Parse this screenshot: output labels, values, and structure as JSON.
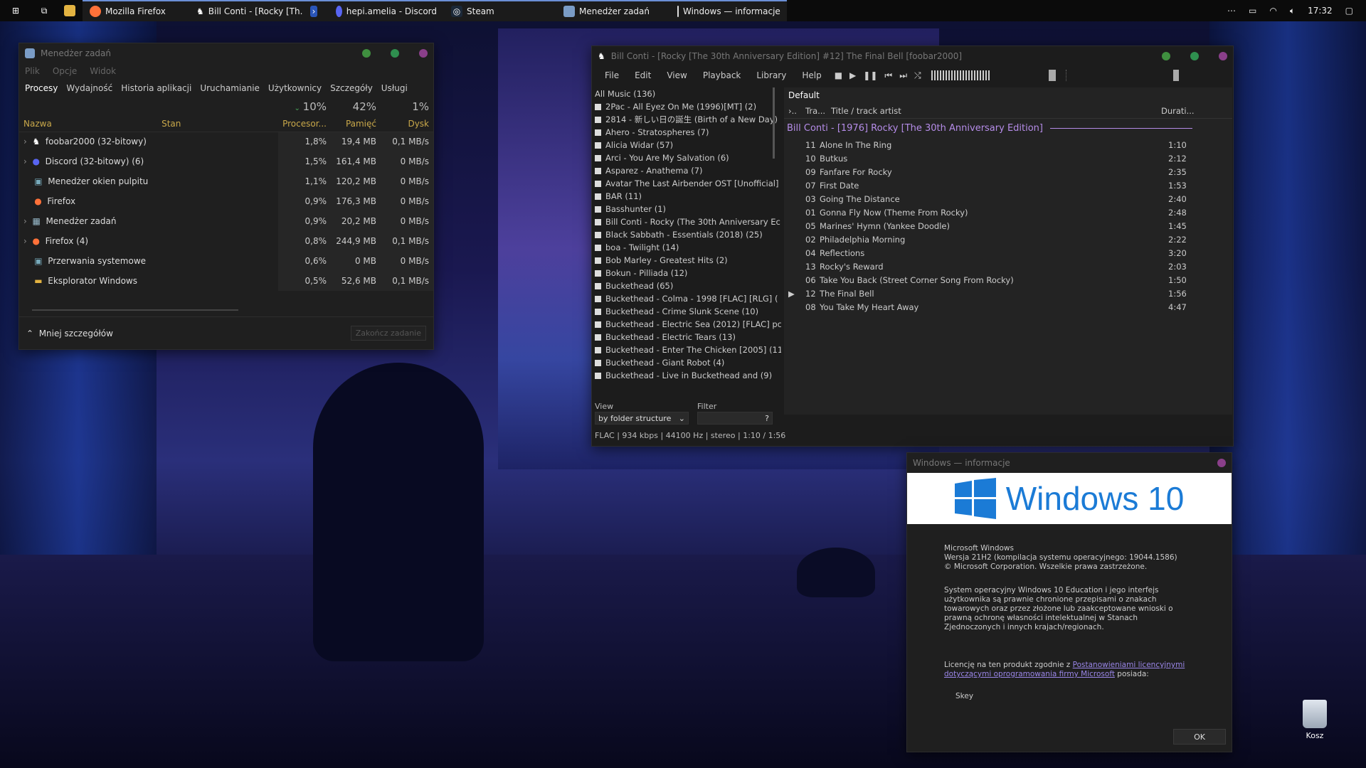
{
  "taskbar": {
    "items": [
      {
        "label": "Mozilla Firefox"
      },
      {
        "label": "Bill Conti - [Rocky [Th..."
      },
      {
        "label": ""
      },
      {
        "label": "hepi.amelia - Discord"
      },
      {
        "label": "Steam"
      },
      {
        "label": "Menedżer zadań"
      },
      {
        "label": "Windows — informacje"
      }
    ],
    "clock": "17:32"
  },
  "taskmgr": {
    "title": "Menedżer zadań",
    "menu": [
      "Plik",
      "Opcje",
      "Widok"
    ],
    "tabs": [
      "Procesy",
      "Wydajność",
      "Historia aplikacji",
      "Uruchamianie",
      "Użytkownicy",
      "Szczegóły",
      "Usługi"
    ],
    "summary": {
      "cpu": "10%",
      "mem": "42%",
      "disk": "1%"
    },
    "columns": {
      "name": "Nazwa",
      "status": "Stan",
      "cpu": "Procesor...",
      "mem": "Pamięć",
      "disk": "Dysk"
    },
    "rows": [
      {
        "name": "foobar2000 (32-bitowy)",
        "cpu": "1,8%",
        "mem": "19,4 MB",
        "disk": "0,1 MB/s"
      },
      {
        "name": "Discord (32-bitowy) (6)",
        "cpu": "1,5%",
        "mem": "161,4 MB",
        "disk": "0 MB/s"
      },
      {
        "name": "Menedżer okien pulpitu",
        "cpu": "1,1%",
        "mem": "120,2 MB",
        "disk": "0 MB/s"
      },
      {
        "name": "Firefox",
        "cpu": "0,9%",
        "mem": "176,3 MB",
        "disk": "0 MB/s"
      },
      {
        "name": "Menedżer zadań",
        "cpu": "0,9%",
        "mem": "20,2 MB",
        "disk": "0 MB/s"
      },
      {
        "name": "Firefox (4)",
        "cpu": "0,8%",
        "mem": "244,9 MB",
        "disk": "0,1 MB/s"
      },
      {
        "name": "Przerwania systemowe",
        "cpu": "0,6%",
        "mem": "0 MB",
        "disk": "0 MB/s"
      },
      {
        "name": "Eksplorator Windows",
        "cpu": "0,5%",
        "mem": "52,6 MB",
        "disk": "0,1 MB/s"
      }
    ],
    "less_details": "Mniej szczegółów",
    "end_task": "Zakończ zadanie"
  },
  "foobar": {
    "title": "Bill Conti - [Rocky [The 30th Anniversary Edition] #12] The Final Bell  [foobar2000]",
    "menu": [
      "File",
      "Edit",
      "View",
      "Playback",
      "Library",
      "Help"
    ],
    "library_root": "All Music (136)",
    "library": [
      "2Pac - All Eyez On Me (1996)[MT] (2)",
      "2814 - 新しい日の誕生 (Birth of a New Day)",
      "Ahero - Stratospheres (7)",
      "Alicia Widar (57)",
      "Arci - You Are My Salvation (6)",
      "Asparez - Anathema (7)",
      "Avatar The Last Airbender OST [Unofficial]",
      "BAR (11)",
      "Basshunter (1)",
      "Bill Conti - Rocky (The 30th Anniversary Ec",
      "Black Sabbath - Essentials (2018) (25)",
      "boa - Twilight (14)",
      "Bob Marley - Greatest Hits (2)",
      "Bokun - Pilliada (12)",
      "Buckethead (65)",
      "Buckethead - Colma - 1998 [FLAC] [RLG] (",
      "Buckethead - Crime Slunk Scene (10)",
      "Buckethead - Electric Sea (2012) [FLAC] pc",
      "Buckethead - Electric Tears (13)",
      "Buckethead - Enter The Chicken [2005] (11",
      "Buckethead - Giant Robot (4)",
      "Buckethead - Live in Buckethead and (9)"
    ],
    "view_label": "View",
    "view_value": "by folder structure",
    "filter_label": "Filter",
    "playlist_tab": "Default",
    "col_track": "Tra...",
    "col_title": "Title / track artist",
    "col_duration": "Durati...",
    "album_header": "Bill Conti - [1976] Rocky [The 30th Anniversary Edition]",
    "tracks": [
      {
        "no": "11",
        "title": "Alone In The Ring",
        "dur": "1:10"
      },
      {
        "no": "10",
        "title": "Butkus",
        "dur": "2:12"
      },
      {
        "no": "09",
        "title": "Fanfare For Rocky",
        "dur": "2:35"
      },
      {
        "no": "07",
        "title": "First Date",
        "dur": "1:53"
      },
      {
        "no": "03",
        "title": "Going The Distance",
        "dur": "2:40"
      },
      {
        "no": "01",
        "title": "Gonna Fly Now (Theme From Rocky)",
        "dur": "2:48"
      },
      {
        "no": "05",
        "title": "Marines' Hymn (Yankee Doodle)",
        "dur": "1:45"
      },
      {
        "no": "02",
        "title": "Philadelphia Morning",
        "dur": "2:22"
      },
      {
        "no": "04",
        "title": "Reflections",
        "dur": "3:20"
      },
      {
        "no": "13",
        "title": "Rocky's Reward",
        "dur": "2:03"
      },
      {
        "no": "06",
        "title": "Take You Back (Street Corner Song From Rocky)",
        "dur": "1:50"
      },
      {
        "no": "12",
        "title": "The Final Bell",
        "dur": "1:56"
      },
      {
        "no": "08",
        "title": "You Take My Heart Away",
        "dur": "4:47"
      }
    ],
    "status": "FLAC | 934 kbps | 44100 Hz | stereo | 1:10 / 1:56"
  },
  "about": {
    "title": "Windows — informacje",
    "logo_text": "Windows 10",
    "line1": "Microsoft Windows",
    "line2": "Wersja 21H2 (kompilacja systemu operacyjnego: 19044.1586)",
    "line3": "© Microsoft Corporation. Wszelkie prawa zastrzeżone.",
    "para": "System operacyjny Windows 10 Education i jego interfejs użytkownika są prawnie chronione przepisami o znakach towarowych oraz przez złożone lub zaakceptowane wnioski o prawną ochronę własności intelektualnej w Stanach Zjednoczonych i innych krajach/regionach.",
    "license_pre": "Licencję na ten produkt zgodnie z ",
    "license_link": "Postanowieniami licencyjnymi dotyczącymi oprogramowania firmy Microsoft",
    "license_post": " posiada:",
    "owner": "Skey",
    "ok": "OK"
  },
  "desktop": {
    "recycle_bin": "Kosz"
  },
  "colors": {
    "accent": "#9a86e8",
    "taskmgr_header": "#c9a84a",
    "win_blue": "#1b7bd6"
  }
}
